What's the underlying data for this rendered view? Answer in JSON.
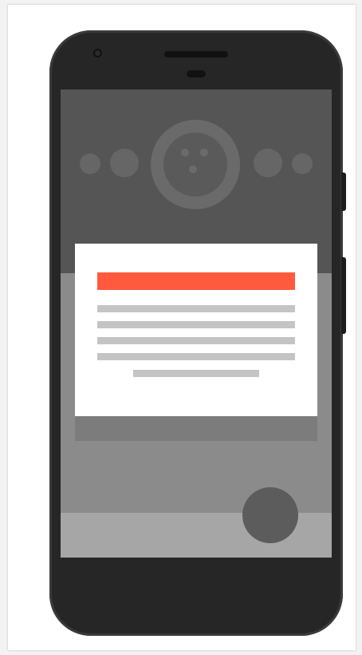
{
  "illustration": {
    "description_icon": "phone-icon",
    "colors": {
      "phone_body": "#262626",
      "screen_top": "#555555",
      "screen_middle": "#8b8b8b",
      "screen_bottom": "#a6a6a6",
      "card": "#ffffff",
      "card_accent": "#ff5a3d",
      "card_lines": "#c4c4c4",
      "fab": "#5c5c5c"
    },
    "card": {
      "title_placeholder_lines": 1,
      "text_placeholder_lines": 5
    }
  }
}
